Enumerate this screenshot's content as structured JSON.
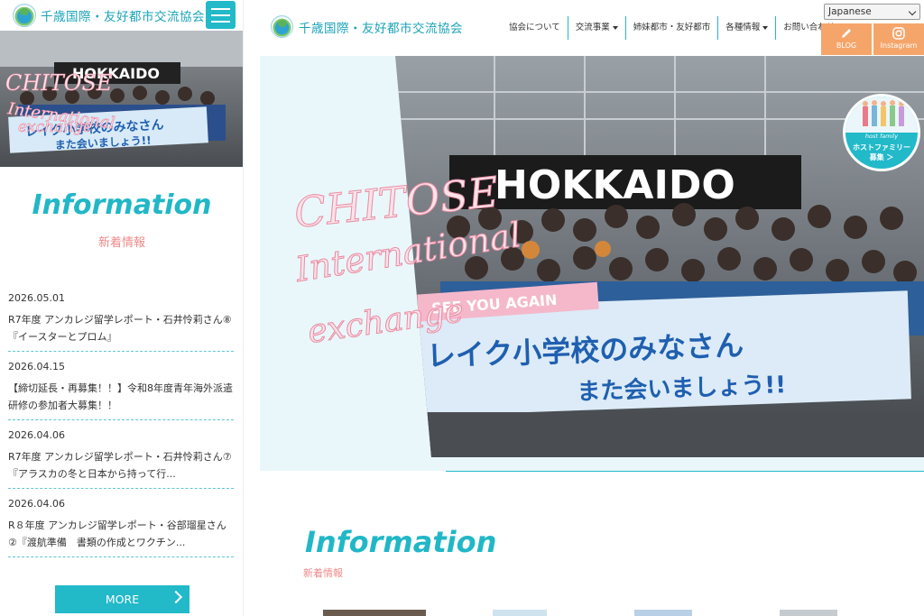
{
  "site": {
    "name": "千歳国際・友好都市交流協会",
    "hero_text": [
      "CHITOSE",
      "International",
      "exchange"
    ],
    "banner_text": [
      "SEE YOU AGAIN",
      "レイク小学校のみなさん",
      "また会いましょう!!"
    ],
    "sign_text": "HOKKAIDO"
  },
  "left": {
    "info_title": "Information",
    "info_sub": "新着情報",
    "news": [
      {
        "date": "2026.05.01",
        "title": "R7年度 アンカレジ留学レポート・石井怜莉さん⑧『イースターとプロム』"
      },
      {
        "date": "2026.04.15",
        "title": "【締切延長・再募集！！】令和8年度青年海外派遣研修の参加者大募集！！"
      },
      {
        "date": "2026.04.06",
        "title": "R7年度 アンカレジ留学レポート・石井怜莉さん⑦『アラスカの冬と日本から持って行..."
      },
      {
        "date": "2026.04.06",
        "title": "R８年度 アンカレジ留学レポート・谷部瑠星さん②『渡航準備　書類の作成とワクチン..."
      }
    ],
    "more_label": "MORE"
  },
  "nav": {
    "items": [
      {
        "label": "協会について",
        "dropdown": false
      },
      {
        "label": "交流事業",
        "dropdown": true
      },
      {
        "label": "姉妹都市・友好都市",
        "dropdown": false
      },
      {
        "label": "各種情報",
        "dropdown": true
      },
      {
        "label": "お問い合わせ",
        "dropdown": false
      }
    ],
    "language": "Japanese",
    "blog_label": "BLOG",
    "instagram_label": "Instagram"
  },
  "hostfamily": {
    "line1": "host family",
    "line2": "ホストファミリー",
    "line3": "募集 ＞"
  },
  "main": {
    "info_title": "Information",
    "info_sub": "新着情報"
  },
  "colors": {
    "accent": "#22b9c9",
    "pink": "#ef8a8a",
    "orange": "#f5a56a"
  }
}
